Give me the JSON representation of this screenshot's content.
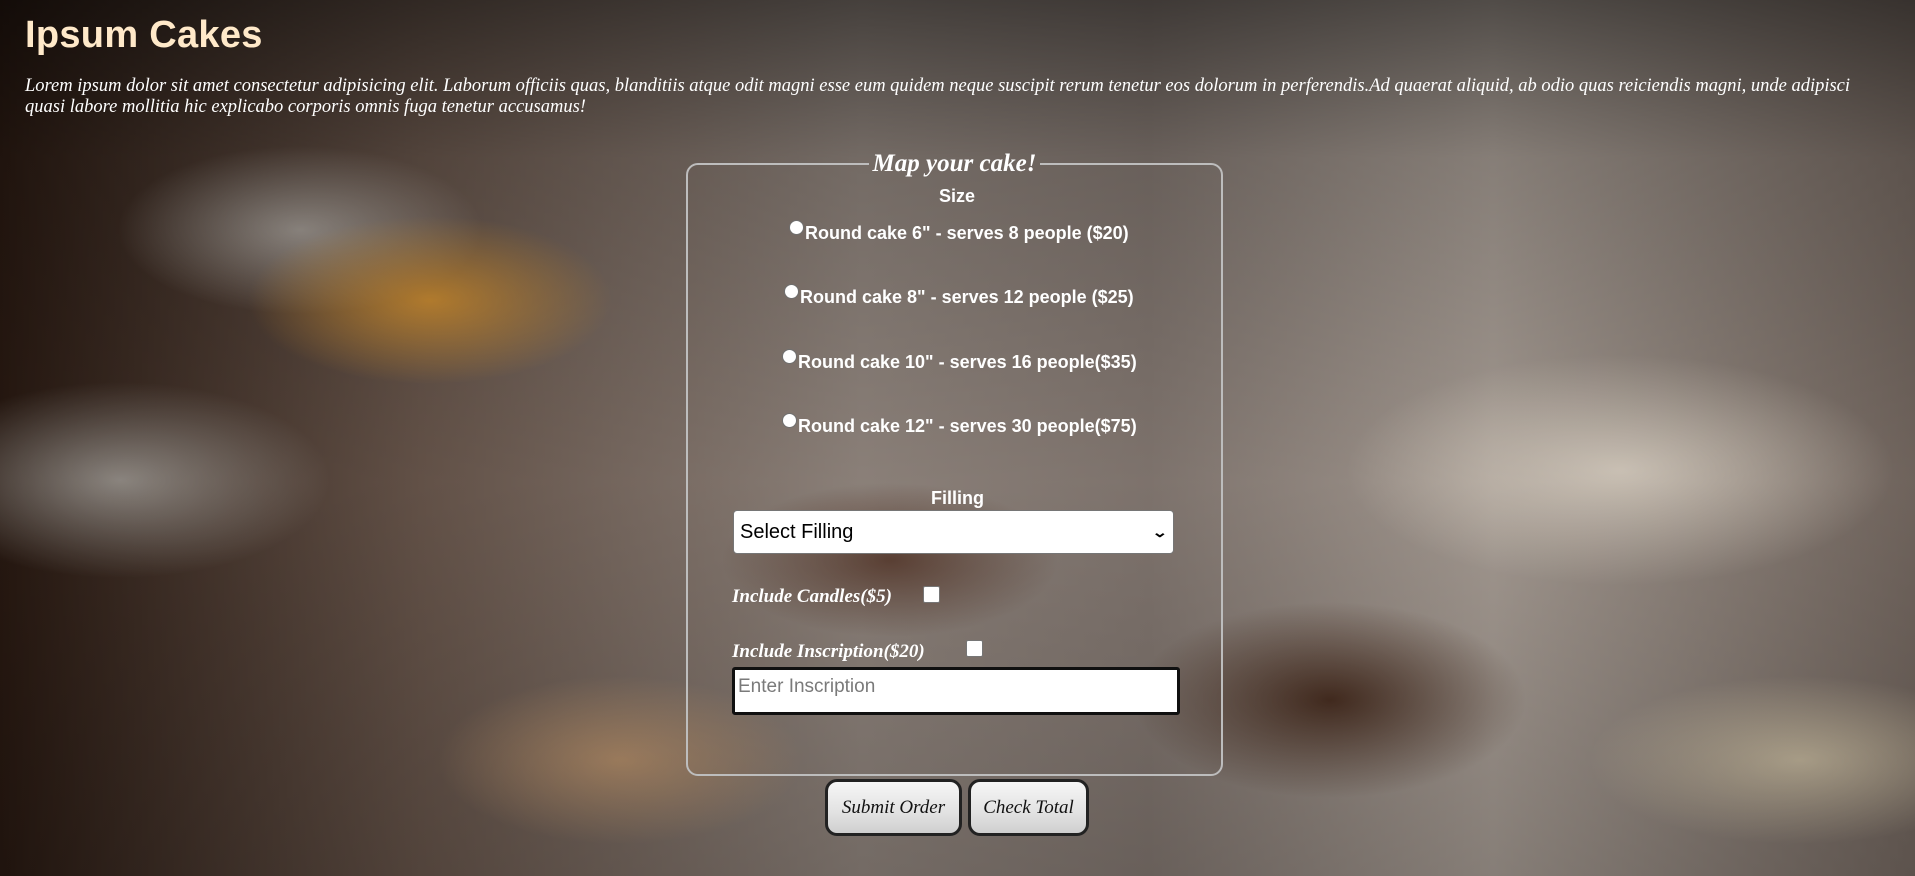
{
  "header": {
    "title": "Ipsum Cakes",
    "intro": "Lorem ipsum dolor sit amet consectetur adipisicing elit. Laborum officiis quas, blanditiis atque odit magni esse eum quidem neque suscipit rerum tenetur eos dolorum in perferendis.Ad quaerat aliquid, ab odio quas reiciendis magni, unde adipisci quasi labore mollitia hic explicabo corporis omnis fuga tenetur accusamus!"
  },
  "form": {
    "legend": "Map your cake!",
    "size_label": "Size",
    "sizes": [
      "Round cake 6\" - serves 8 people ($20)",
      "Round cake 8\" - serves 12 people ($25)",
      "Round cake 10\" - serves 16 people($35)",
      "Round cake 12\" - serves 30 people($75)"
    ],
    "filling_label": "Filling",
    "filling_selected": "Select Filling",
    "candles_label": "Include Candles($5)",
    "inscription_label": "Include Inscription($20)",
    "inscription_placeholder": "Enter Inscription"
  },
  "buttons": {
    "submit": "Submit Order",
    "check_total": "Check Total"
  },
  "icons": {
    "select_arrow": "chevron-down-icon"
  }
}
